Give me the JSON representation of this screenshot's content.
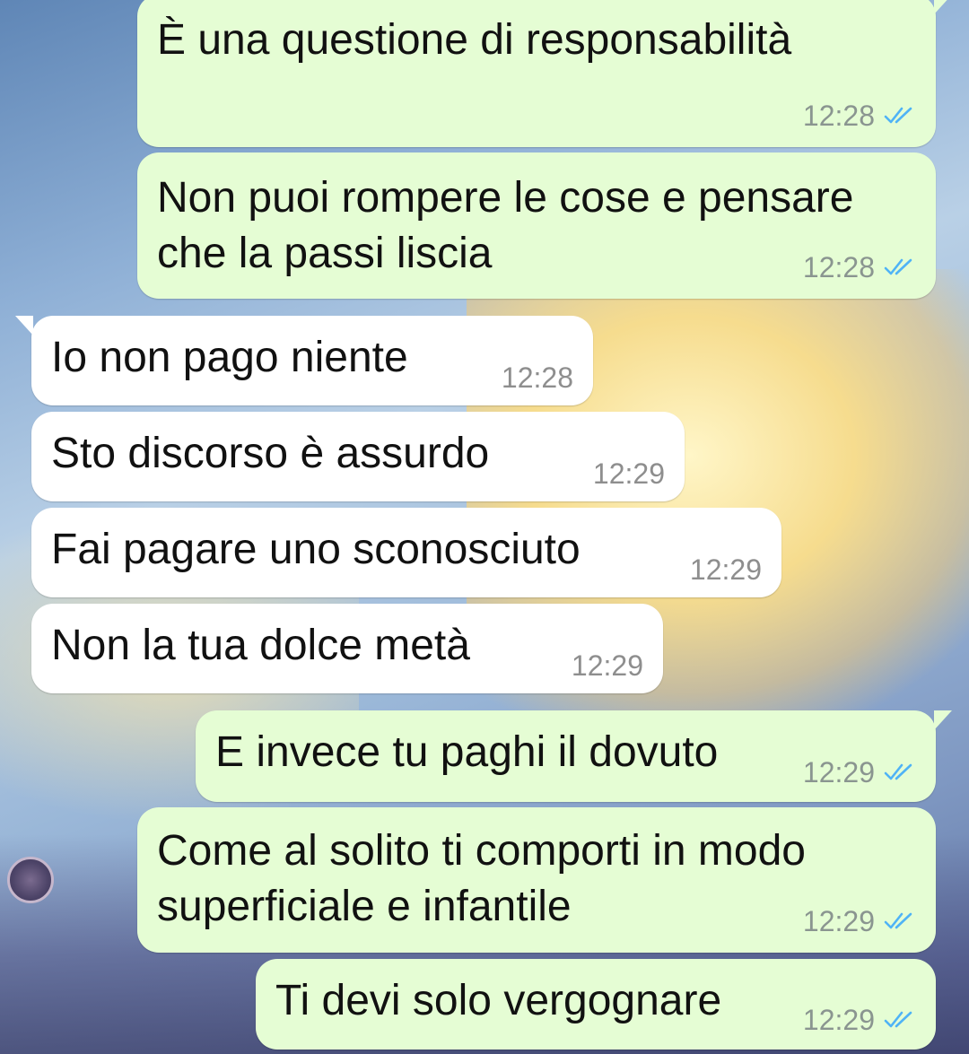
{
  "colors": {
    "outgoing_bubble": "#e5fdd4",
    "incoming_bubble": "#ffffff",
    "read_ticks": "#4fb3f6",
    "timestamp": "#8a9590"
  },
  "messages": [
    {
      "direction": "outgoing",
      "text": "È una questione di responsabilità",
      "time": "12:28",
      "status_icon": "double-check-read-icon"
    },
    {
      "direction": "outgoing",
      "text": "Non puoi rompere le cose e pensare\nche la passi liscia",
      "time": "12:28",
      "status_icon": "double-check-read-icon"
    },
    {
      "direction": "incoming",
      "text": "Io non pago niente",
      "time": "12:28"
    },
    {
      "direction": "incoming",
      "text": "Sto discorso è assurdo",
      "time": "12:29"
    },
    {
      "direction": "incoming",
      "text": "Fai pagare uno sconosciuto",
      "time": "12:29"
    },
    {
      "direction": "incoming",
      "text": "Non la tua dolce metà",
      "time": "12:29"
    },
    {
      "direction": "outgoing",
      "text": "E invece tu paghi il dovuto",
      "time": "12:29",
      "status_icon": "double-check-read-icon"
    },
    {
      "direction": "outgoing",
      "text": "Come al solito ti comporti in modo\nsuperficiale e infantile",
      "time": "12:29",
      "status_icon": "double-check-read-icon"
    },
    {
      "direction": "outgoing",
      "text": "Ti devi solo vergognare",
      "time": "12:29",
      "status_icon": "double-check-read-icon"
    }
  ]
}
